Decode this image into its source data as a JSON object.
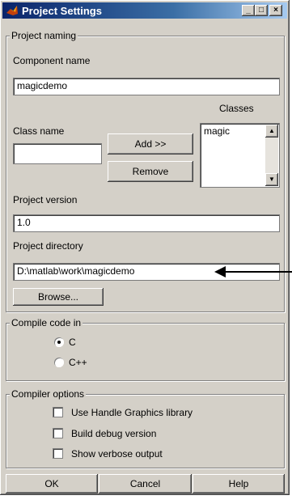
{
  "window": {
    "title": "Project Settings",
    "controls": [
      "minimize-icon",
      "maximize-icon",
      "close-icon"
    ]
  },
  "naming": {
    "group_title": "Project naming",
    "component_label": "Component name",
    "component_value": "magicdemo",
    "classes_label": "Classes",
    "class_name_label": "Class name",
    "class_name_value": "",
    "add_label": "Add >>",
    "remove_label": "Remove",
    "classes_list": [
      "magic"
    ],
    "version_label": "Project version",
    "version_value": "1.0",
    "directory_label": "Project directory",
    "directory_value": "D:\\matlab\\work\\magicdemo",
    "browse_label": "Browse..."
  },
  "compile": {
    "group_title": "Compile code in",
    "options": [
      {
        "label": "C",
        "selected": true
      },
      {
        "label": "C++",
        "selected": false
      }
    ]
  },
  "compiler_options": {
    "group_title": "Compiler options",
    "options": [
      {
        "label": "Use Handle Graphics library",
        "checked": false
      },
      {
        "label": "Build debug version",
        "checked": false
      },
      {
        "label": "Show verbose output",
        "checked": false
      }
    ]
  },
  "footer": {
    "ok_label": "OK",
    "cancel_label": "Cancel",
    "help_label": "Help"
  },
  "colors": {
    "titlebar_start": "#0a246a",
    "titlebar_end": "#a6caf0",
    "face": "#d4d0c8"
  }
}
